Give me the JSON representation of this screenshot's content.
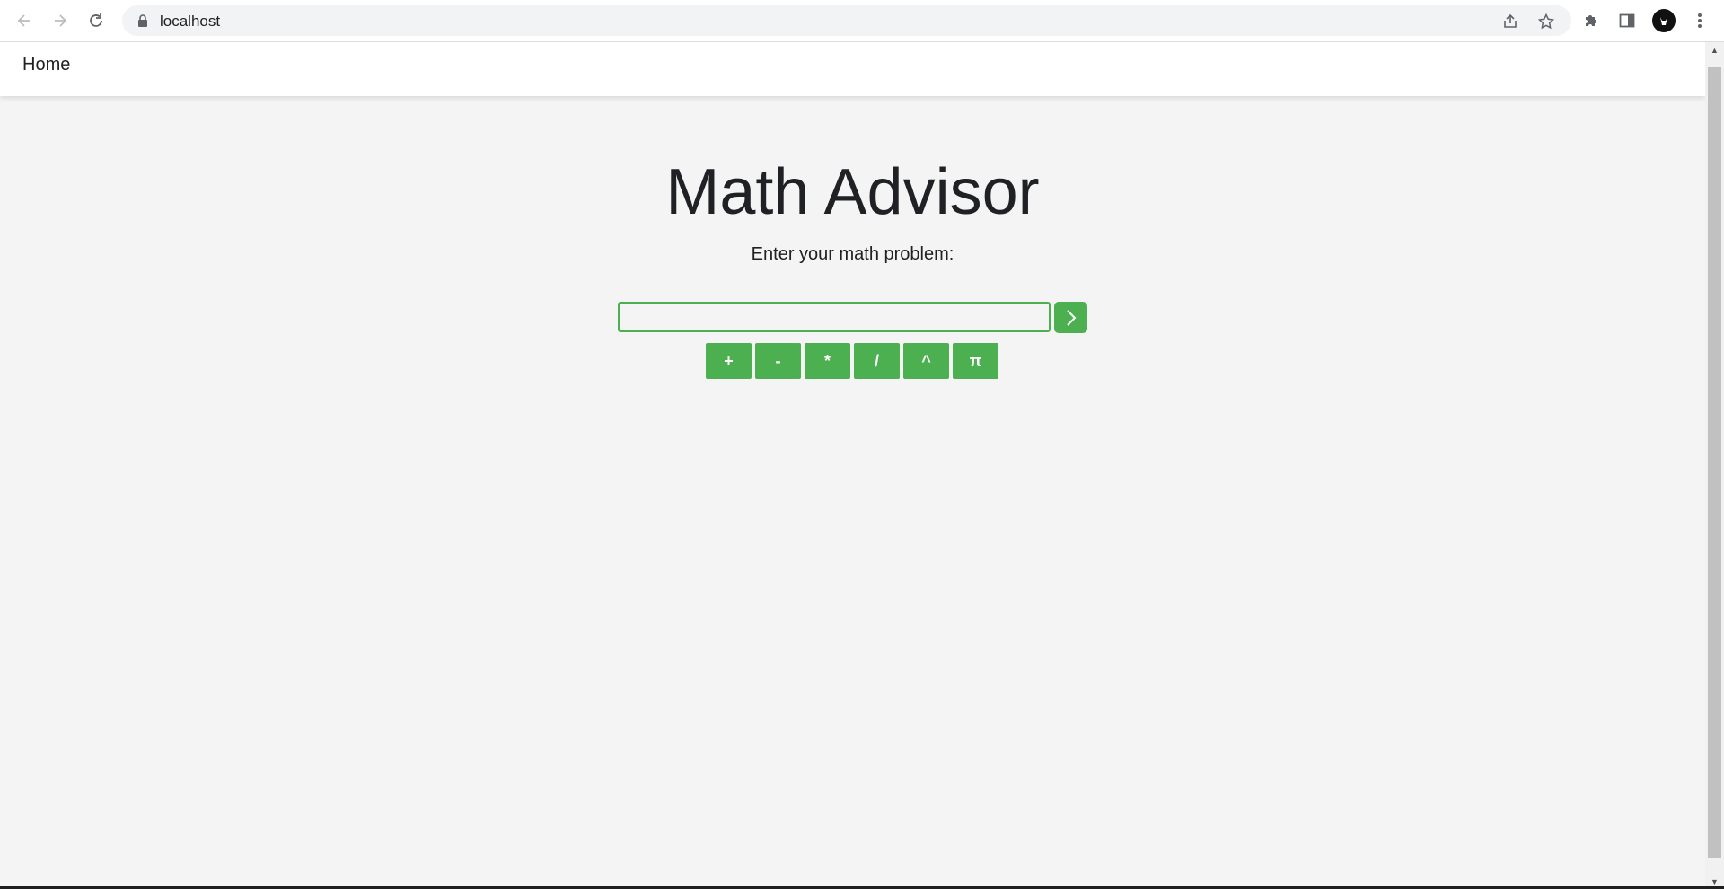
{
  "browser": {
    "url": "localhost"
  },
  "nav": {
    "home_label": "Home"
  },
  "main": {
    "title": "Math Advisor",
    "prompt": "Enter your math problem:",
    "input_value": "",
    "operators": [
      "+",
      "-",
      "*",
      "/",
      "^",
      "π"
    ]
  },
  "colors": {
    "accent": "#4caf50",
    "background": "#f4f4f4"
  }
}
